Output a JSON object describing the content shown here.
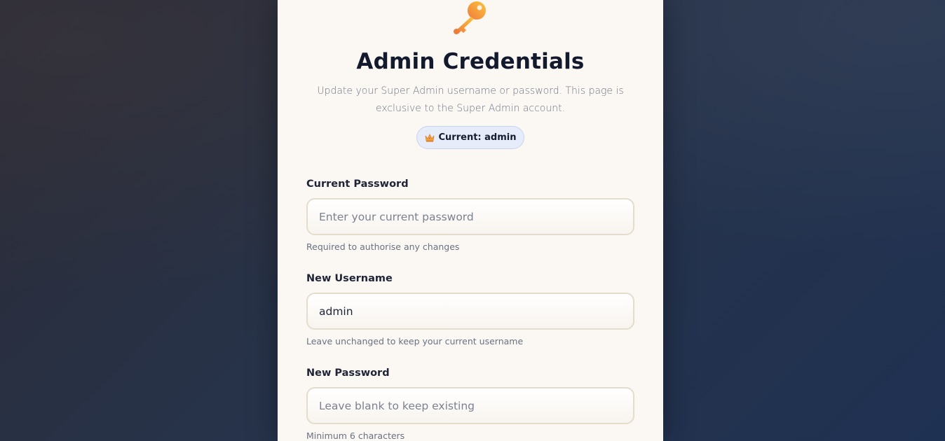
{
  "page": {
    "title": "Admin Credentials",
    "subtitle": "Update your Super Admin username or password. This page is exclusive to the Super Admin account.",
    "badge": {
      "icon": "crown-icon",
      "text": "Current: admin"
    },
    "header_icon": "key-icon"
  },
  "form": {
    "current_password": {
      "label": "Current Password",
      "placeholder": "Enter your current password",
      "value": "",
      "hint": "Required to authorise any changes"
    },
    "new_username": {
      "label": "New Username",
      "placeholder": "",
      "value": "admin",
      "hint": "Leave unchanged to keep your current username"
    },
    "new_password": {
      "label": "New Password",
      "placeholder": "Leave blank to keep existing",
      "value": "",
      "hint": "Minimum 6 characters"
    }
  },
  "colors": {
    "card_background": "#fbf8f4",
    "badge_background": "#e6ecf9",
    "title_text": "#141a2e",
    "input_border": "#e4dccd"
  }
}
